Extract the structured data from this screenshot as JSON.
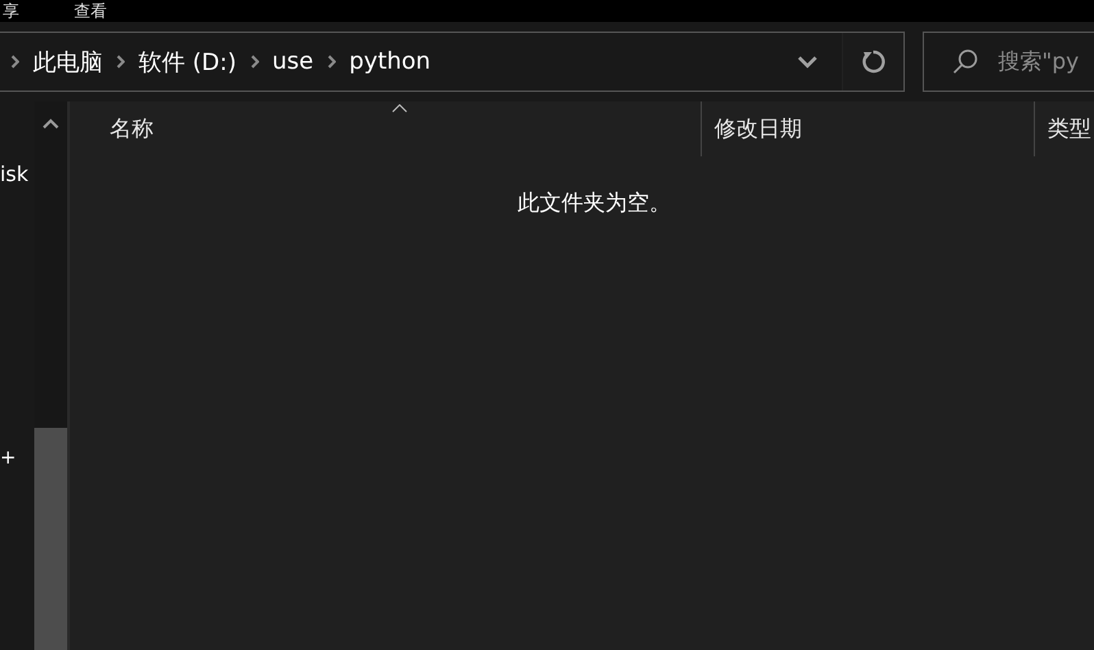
{
  "ribbon_tabs": [
    {
      "label": "享"
    },
    {
      "label": "查看"
    }
  ],
  "address_bar": {
    "breadcrumbs": [
      "此电脑",
      "软件 (D:)",
      "use",
      "python"
    ]
  },
  "search": {
    "placeholder": "搜索\"py"
  },
  "navigation_pane": {
    "items": [
      "isk",
      "+"
    ]
  },
  "file_list": {
    "columns": [
      {
        "label": "名称",
        "sorted": true
      },
      {
        "label": "修改日期",
        "sorted": false
      },
      {
        "label": "类型",
        "sorted": false
      }
    ],
    "empty_message": "此文件夹为空。"
  }
}
